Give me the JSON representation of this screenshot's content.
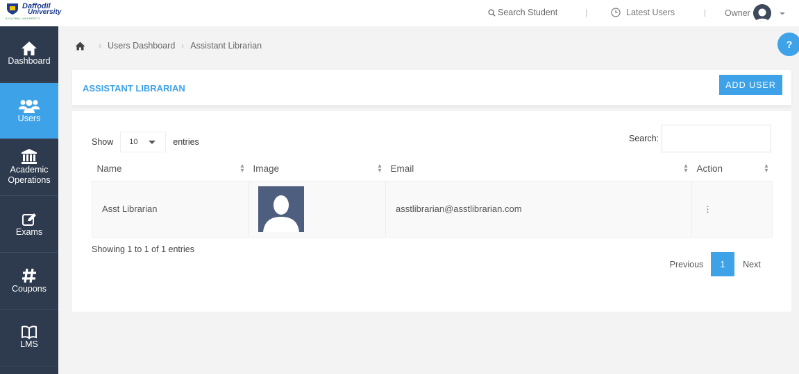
{
  "brand": {
    "line1": "Daffodil",
    "line2": "University",
    "tagline": "A GLOBAL UNIVERSITY"
  },
  "topbar": {
    "search_label": "Search Student",
    "separator": "|",
    "latest_label": "Latest Users",
    "owner_label": "Owner"
  },
  "sidebar": {
    "items": [
      {
        "label": "Dashboard",
        "icon": "home-icon"
      },
      {
        "label": "Users",
        "icon": "users-icon",
        "active": true
      },
      {
        "label": "Academic Operations",
        "icon": "institution-icon"
      },
      {
        "label": "Exams",
        "icon": "edit-icon"
      },
      {
        "label": "Coupons",
        "icon": "hash-icon"
      },
      {
        "label": "LMS",
        "icon": "book-icon"
      }
    ]
  },
  "help_label": "?",
  "breadcrumb": {
    "items": [
      "Users Dashboard",
      "Assistant Librarian"
    ]
  },
  "card": {
    "title": "ASSISTANT LIBRARIAN",
    "add_button": "ADD USER"
  },
  "table_controls": {
    "show_label": "Show",
    "length_value": "10",
    "entries_label": "entries",
    "search_label": "Search:"
  },
  "table": {
    "columns": [
      "Name",
      "Image",
      "Email",
      "Action"
    ],
    "rows": [
      {
        "name": "Asst Librarian",
        "email": "asstlibrarian@asstlibrarian.com"
      }
    ]
  },
  "pagination": {
    "info": "Showing 1 to 1 of 1 entries",
    "previous": "Previous",
    "current": "1",
    "next": "Next"
  },
  "colors": {
    "accent": "#3ea2e8",
    "sidebar": "#2e3b4e"
  }
}
